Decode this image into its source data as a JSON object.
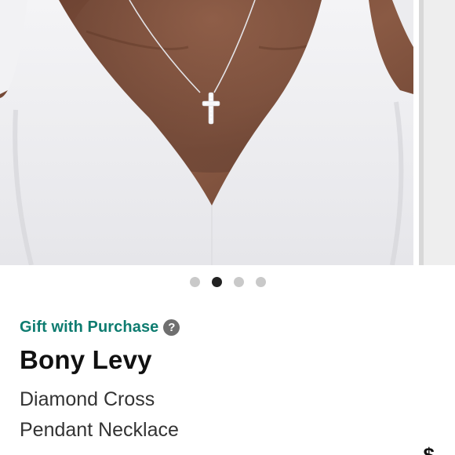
{
  "product": {
    "gift_label": "Gift with Purchase",
    "help_icon_glyph": "?",
    "brand": "Bony Levy",
    "name_line1": "Diamond Cross",
    "name_line2": "Pendant Necklace",
    "price_visible": "$"
  },
  "carousel": {
    "slide_count": 4,
    "active_index": 1
  },
  "colors": {
    "gift_link": "#0e7c70",
    "dot_active": "#222222",
    "dot_inactive": "#c9c9c9"
  }
}
